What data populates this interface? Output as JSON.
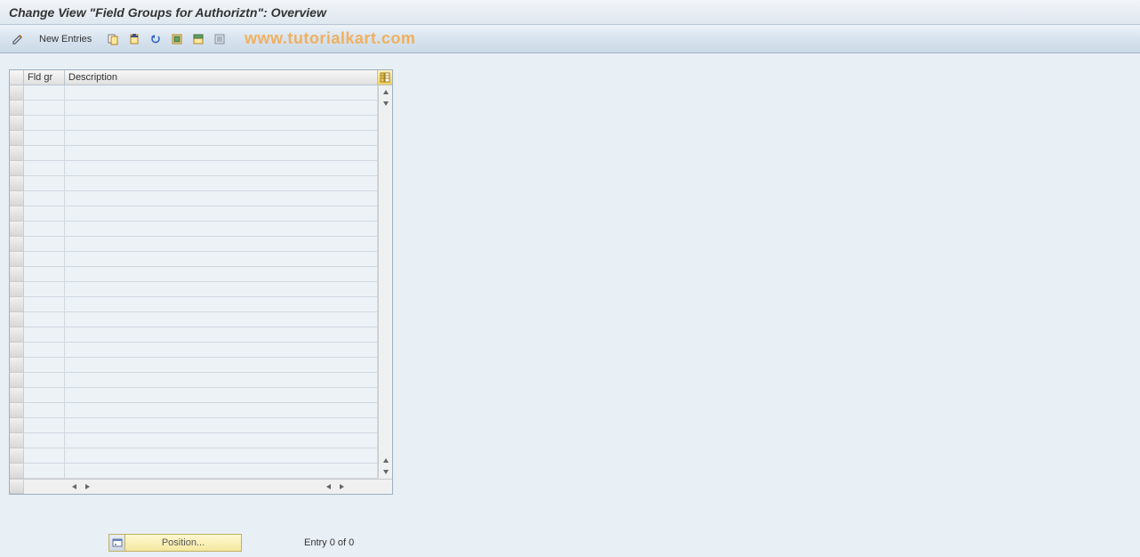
{
  "title": "Change View \"Field Groups for Authoriztn\": Overview",
  "toolbar": {
    "new_entries_label": "New Entries"
  },
  "watermark": "www.tutorialkart.com",
  "table": {
    "columns": {
      "fld_gr": "Fld gr",
      "description": "Description"
    },
    "row_count": 26
  },
  "footer": {
    "position_label": "Position...",
    "entry_status": "Entry 0 of 0"
  }
}
